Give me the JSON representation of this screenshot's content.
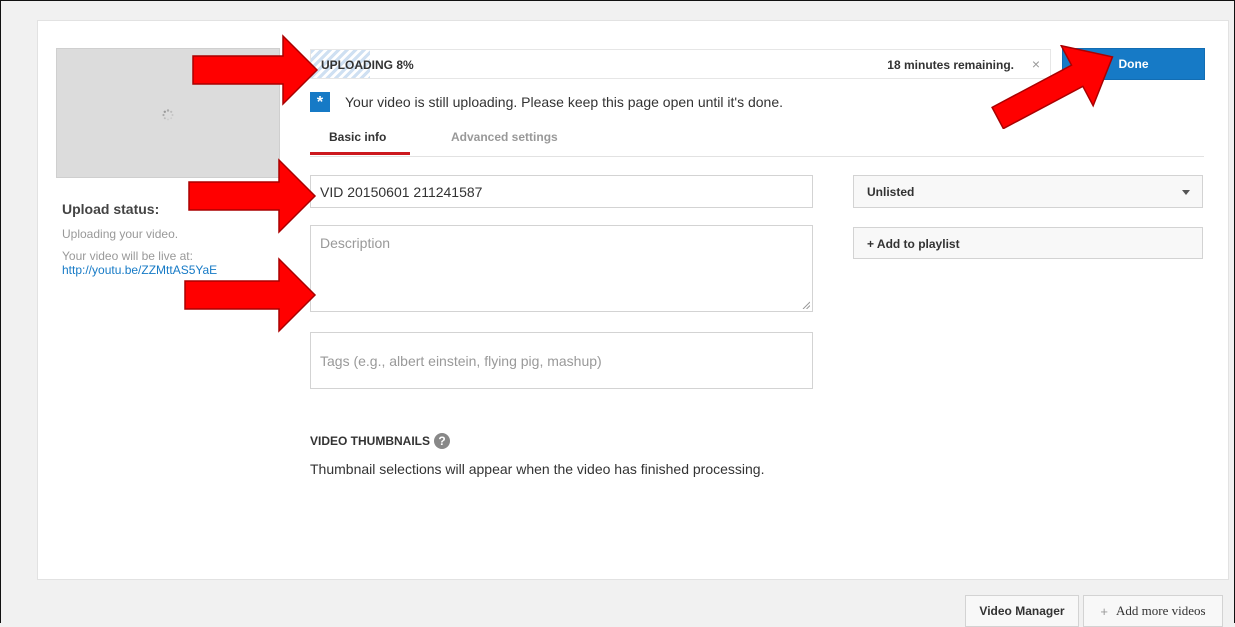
{
  "upload": {
    "progress_label": "UPLOADING 8%",
    "progress_percent": 8,
    "remaining": "18 minutes remaining.",
    "close_glyph": "×"
  },
  "done_button": {
    "label": "Done"
  },
  "notice": {
    "icon_glyph": "*",
    "text": "Your video is still uploading. Please keep this page open until it's done."
  },
  "tabs": [
    {
      "label": "Basic info",
      "active": true
    },
    {
      "label": "Advanced settings",
      "active": false
    }
  ],
  "upload_status": {
    "title": "Upload status:",
    "line1": "Uploading your video.",
    "line2": "Your video will be live at:",
    "link": "http://youtu.be/ZZMttAS5YaE"
  },
  "form": {
    "title_value": "VID 20150601 211241587",
    "description_placeholder": "Description",
    "tags_placeholder": "Tags (e.g., albert einstein, flying pig, mashup)"
  },
  "privacy": {
    "selected": "Unlisted"
  },
  "playlist": {
    "label": "+ Add to playlist"
  },
  "thumbnails": {
    "heading": "VIDEO THUMBNAILS",
    "help_glyph": "?",
    "message": "Thumbnail selections will appear when the video has finished processing."
  },
  "footer": {
    "video_manager": "Video Manager",
    "add_more_plus": "+",
    "add_more": "Add more videos"
  },
  "colors": {
    "accent_blue": "#167ac6",
    "tab_red": "#cc181e",
    "arrow_red": "#ff0000"
  }
}
